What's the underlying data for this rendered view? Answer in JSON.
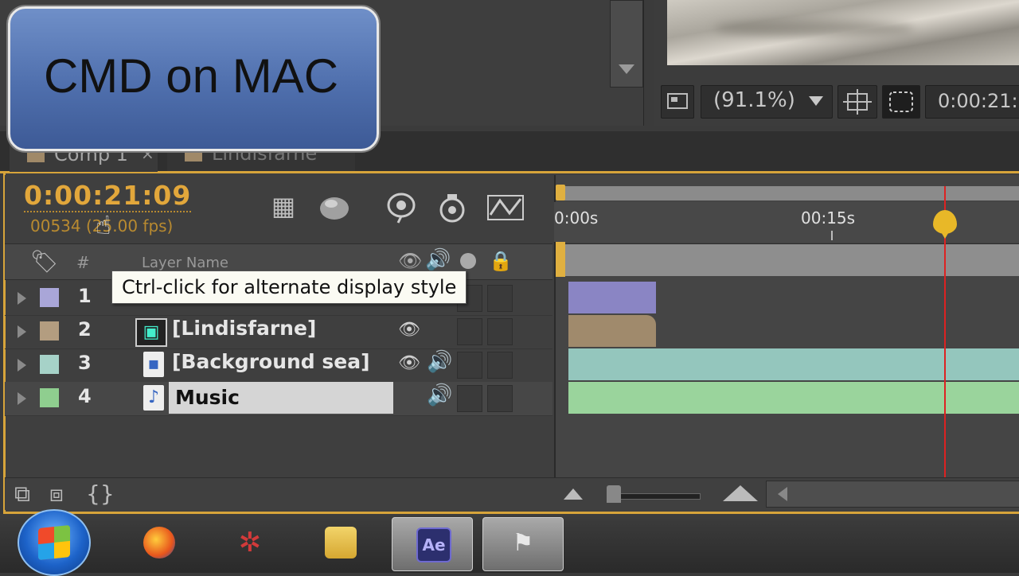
{
  "overlay": {
    "caption": "CMD on MAC"
  },
  "viewer": {
    "zoom": "(91.1%)",
    "timecode": "0:00:21:"
  },
  "tabs": [
    {
      "label": "Comp 1",
      "close": "×",
      "active": true
    },
    {
      "label": "Lindisfarne",
      "active": false
    }
  ],
  "timeline": {
    "timecode": "0:00:21:09",
    "frames": "00534 (25.00 fps)",
    "columns": {
      "hash": "#",
      "layer_name": "Layer Name"
    },
    "tooltip": "Ctrl-click for alternate display style",
    "ruler": {
      "start": "0:00s",
      "mark_15": "00:15s"
    },
    "layers": [
      {
        "num": "1",
        "name": "",
        "color": "#a9a6d8",
        "visible": true,
        "audio": false
      },
      {
        "num": "2",
        "name": "[Lindisfarne]",
        "color": "#b39d80",
        "visible": true,
        "audio": false
      },
      {
        "num": "3",
        "name": "[Background sea]",
        "color": "#a6d2c8",
        "visible": true,
        "audio": true
      },
      {
        "num": "4",
        "name": "Music",
        "color": "#8fce8f",
        "visible": false,
        "audio": true,
        "selected": true
      }
    ]
  },
  "colors": {
    "accent": "#d7a43a",
    "cti": "#dd2222",
    "timecode": "#e2a73b"
  },
  "taskbar": {
    "items": [
      {
        "name": "start-button",
        "icon": "windows-orb-icon"
      },
      {
        "name": "firefox",
        "icon": "firefox-icon"
      },
      {
        "name": "app",
        "icon": "app-icon"
      },
      {
        "name": "file-explorer",
        "icon": "folder-icon"
      },
      {
        "name": "after-effects",
        "icon": "after-effects-icon",
        "label": "Ae",
        "active": true
      },
      {
        "name": "app",
        "icon": "flag-app-icon"
      }
    ]
  }
}
